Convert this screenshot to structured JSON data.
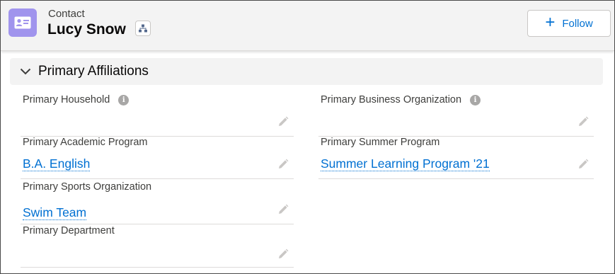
{
  "header": {
    "object_label": "Contact",
    "record_name": "Lucy Snow",
    "record_icon": "contact-card-icon",
    "hierarchy_icon": "hierarchy-icon",
    "follow_button": {
      "label": "Follow",
      "icon": "plus-icon"
    }
  },
  "section": {
    "title": "Primary Affiliations",
    "expanded": true,
    "left_fields": [
      {
        "label": "Primary Household",
        "value": "",
        "has_info": true
      },
      {
        "label": "Primary Academic Program",
        "value": "B.A. English",
        "has_info": false
      },
      {
        "label": "Primary Sports Organization",
        "value": "Swim Team",
        "has_info": false
      },
      {
        "label": "Primary Department",
        "value": "",
        "has_info": false
      }
    ],
    "right_fields": [
      {
        "label": "Primary Business Organization",
        "value": "",
        "has_info": true
      },
      {
        "label": "Primary Summer Program",
        "value": "Summer Learning Program '21",
        "has_info": false
      }
    ]
  },
  "colors": {
    "accent": "#0070d2",
    "contact_icon_bg": "#a094ed",
    "header_bg": "#f3f3f3",
    "text": "#3e3e3c"
  }
}
